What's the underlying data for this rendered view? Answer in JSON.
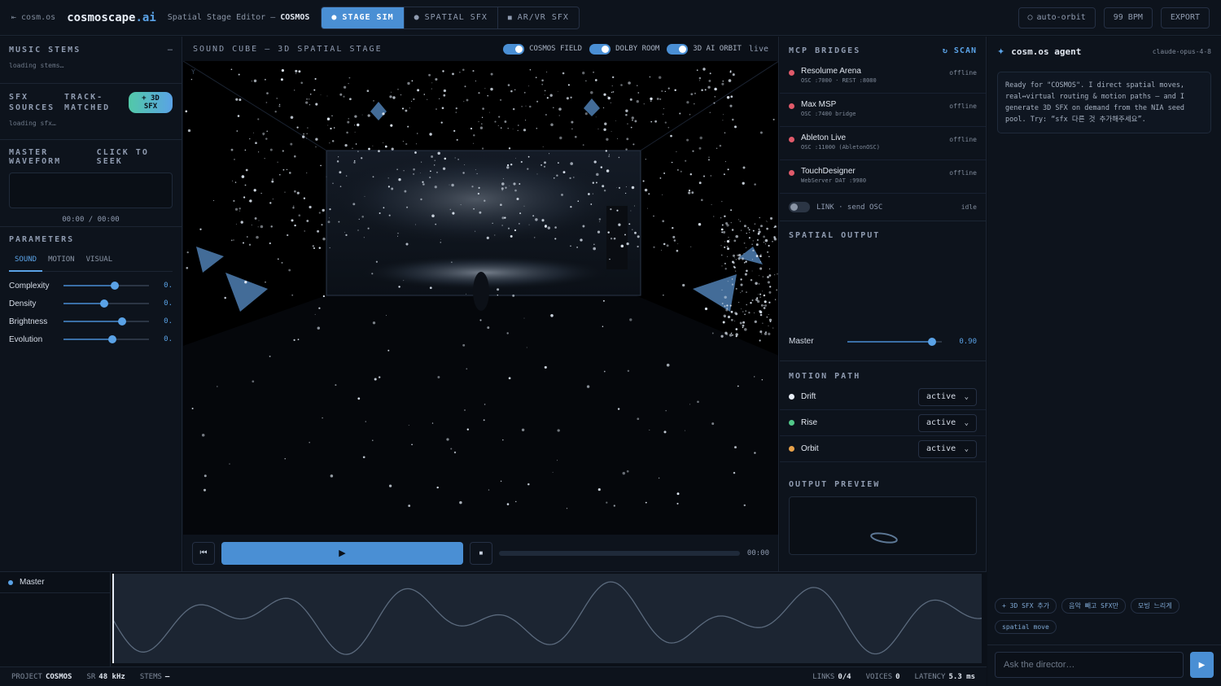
{
  "header": {
    "crumb": "⇤ cosm.os",
    "brand_main": "cosmoscape",
    "brand_suffix": ".ai",
    "subtitle_prefix": "Spatial Stage Editor —",
    "subtitle_project": "COSMOS",
    "modes": [
      {
        "label": "STAGE SIM",
        "icon": "●"
      },
      {
        "label": "SPATIAL SFX",
        "icon": "●"
      },
      {
        "label": "AR/VR SFX",
        "icon": "■"
      }
    ],
    "auto_orbit": "auto-orbit",
    "auto_orbit_icon": "○",
    "bpm": "99 BPM",
    "export": "EXPORT"
  },
  "left": {
    "stems_title": "MUSIC STEMS",
    "stems_collapse": "–",
    "stems_status": "loading stems…",
    "sfx_title_a": "SFX SOURCES",
    "sfx_title_b": "TRACK-MATCHED",
    "sfx_button": "+ 3D SFX",
    "sfx_status": "loading sfx…",
    "waveform_title": "MASTER WAVEFORM",
    "waveform_hint": "CLICK TO SEEK",
    "waveform_time": "00:00 / 00:00",
    "params_title": "PARAMETERS",
    "tabs": [
      "SOUND",
      "MOTION",
      "VISUAL"
    ],
    "params": [
      {
        "label": "Complexity",
        "value": 0.6,
        "text": "0."
      },
      {
        "label": "Density",
        "value": 0.48,
        "text": "0."
      },
      {
        "label": "Brightness",
        "value": 0.69,
        "text": "0."
      },
      {
        "label": "Evolution",
        "value": 0.57,
        "text": "0."
      }
    ]
  },
  "stage": {
    "title": "SOUND CUBE — 3D SPATIAL STAGE",
    "toggles": [
      {
        "label": "COSMOS FIELD",
        "on": true
      },
      {
        "label": "DOLBY ROOM",
        "on": true
      },
      {
        "label": "3D AI ORBIT",
        "on": true
      }
    ],
    "live": "live",
    "axis_label": "Y"
  },
  "transport": {
    "prev_icon": "⏮",
    "play_icon": "▶",
    "stop_icon": "■",
    "time": "00:00",
    "progress": 0
  },
  "bridges": {
    "title": "MCP BRIDGES",
    "scan": "↻ SCAN",
    "items": [
      {
        "name": "Resolume Arena",
        "sub": "OSC :7000 · REST :8080",
        "status": "offline"
      },
      {
        "name": "Max MSP",
        "sub": "OSC :7400 bridge",
        "status": "offline"
      },
      {
        "name": "Ableton Live",
        "sub": "OSC :11000 (AbletonOSC)",
        "status": "offline"
      },
      {
        "name": "TouchDesigner",
        "sub": "WebServer DAT :9980",
        "status": "offline"
      }
    ],
    "link_label": "LINK · send OSC",
    "link_status": "idle"
  },
  "spatial": {
    "title": "SPATIAL OUTPUT",
    "master_label": "Master",
    "master_value": 0.9,
    "master_text": "0.90"
  },
  "motion": {
    "title": "MOTION PATH",
    "items": [
      {
        "label": "Drift",
        "state": "active",
        "color": "#e8eef7"
      },
      {
        "label": "Rise",
        "state": "active",
        "color": "#52c98a"
      },
      {
        "label": "Orbit",
        "state": "active",
        "color": "#e8a24a"
      }
    ]
  },
  "preview": {
    "title": "OUTPUT PREVIEW"
  },
  "agent": {
    "title": "cosm.os agent",
    "model": "claude-opus-4-8",
    "message": "Ready for \"COSMOS\". I direct spatial moves, real↔virtual routing & motion paths — and I generate 3D SFX on demand from the NIA seed pool. Try: “sfx 다른 것 추가해주세요”.",
    "chips": [
      "+ 3D SFX 추가",
      "음악 빼고 SFX만",
      "모빙 느리게",
      "spatial move"
    ],
    "input_placeholder": "Ask the director…",
    "send_icon": "▶"
  },
  "timeline": {
    "track_label": "Master"
  },
  "status": {
    "project_label": "PROJECT",
    "project": "COSMOS",
    "sr_label": "SR",
    "sr": "48 kHz",
    "stems_label": "STEMS",
    "stems": "—",
    "links_label": "LINKS",
    "links": "0/4",
    "voices_label": "VOICES",
    "voices": "0",
    "latency_label": "LATENCY",
    "latency": "5.3 ms"
  },
  "colors": {
    "accent": "#4a8fd4",
    "offline": "#e05a6a",
    "panel": "#0d131c",
    "bg": "#0b1018"
  }
}
